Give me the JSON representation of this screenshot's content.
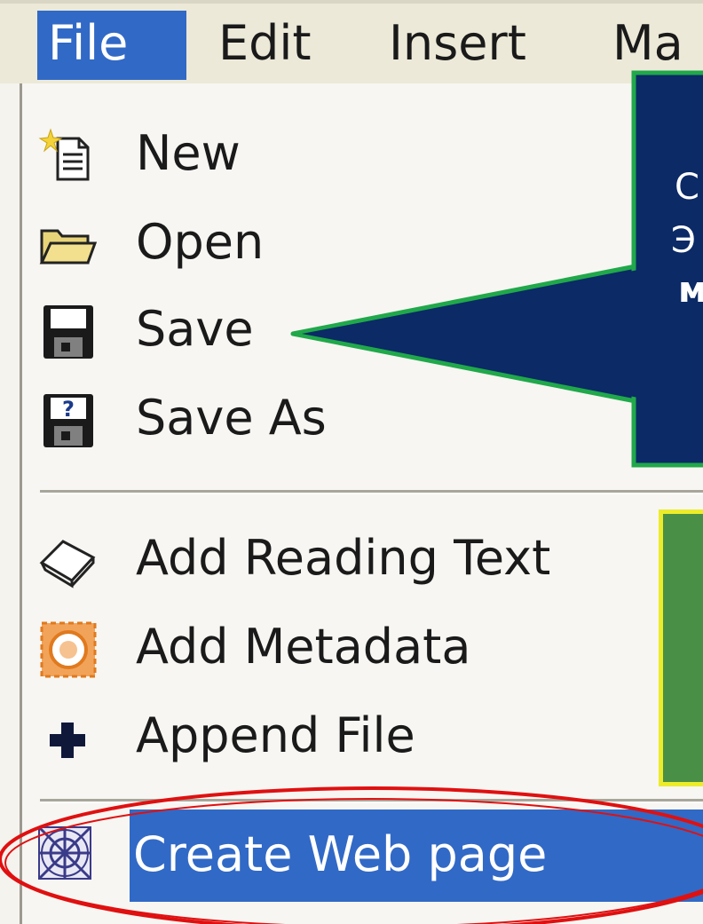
{
  "menubar": {
    "items": [
      {
        "label": "File",
        "active": true
      },
      {
        "label": "Edit"
      },
      {
        "label": "Insert"
      },
      {
        "label": "Ma"
      }
    ]
  },
  "file_menu": {
    "items": [
      {
        "label": "New",
        "icon": "new-document-icon"
      },
      {
        "label": "Open",
        "icon": "open-folder-icon"
      },
      {
        "label": "Save",
        "icon": "floppy-disk-icon"
      },
      {
        "label": "Save As",
        "icon": "save-as-icon"
      },
      {
        "label": "Add Reading Text",
        "icon": "book-icon"
      },
      {
        "label": "Add Metadata",
        "icon": "metadata-icon"
      },
      {
        "label": "Append File",
        "icon": "plus-icon"
      },
      {
        "label": "Create Web page",
        "icon": "web-page-icon",
        "highlighted": true
      }
    ]
  },
  "callout": {
    "lines": [
      "С",
      "Э",
      "м"
    ]
  },
  "colors": {
    "menu_highlight": "#3169c6",
    "callout_fill": "#0b2a66",
    "callout_border": "#20a84a",
    "note_fill": "#4a8f46",
    "note_border": "#ecec2a",
    "annotation_ellipse": "#e01010"
  }
}
